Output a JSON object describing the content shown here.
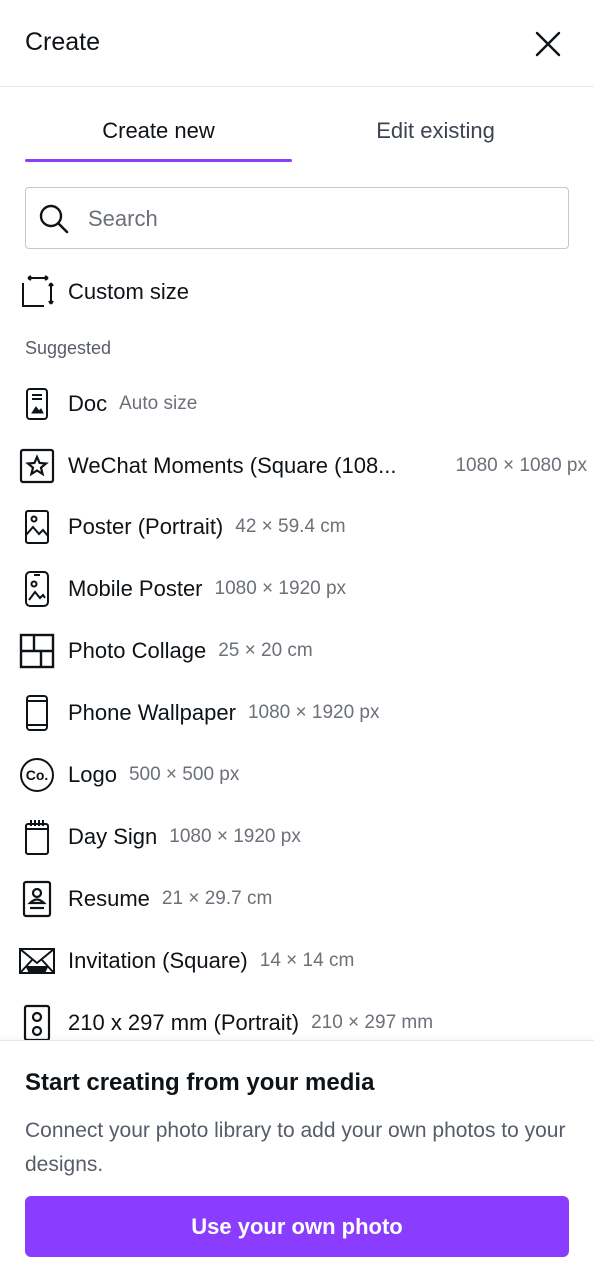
{
  "header": {
    "title": "Create",
    "close_icon": "close-icon"
  },
  "tabs": [
    {
      "label": "Create new",
      "active": true
    },
    {
      "label": "Edit existing",
      "active": false
    }
  ],
  "search": {
    "placeholder": "Search",
    "value": "",
    "icon": "search-icon"
  },
  "custom_size": {
    "label": "Custom size",
    "icon": "resize-icon"
  },
  "suggested_label": "Suggested",
  "suggested": [
    {
      "name": "Doc",
      "dim": "Auto size",
      "icon": "doc-icon"
    },
    {
      "name": "WeChat Moments (Square (108...",
      "dim": "1080 × 1080 px",
      "icon": "star-frame-icon"
    },
    {
      "name": "Poster (Portrait)",
      "dim": "42 × 59.4 cm",
      "icon": "poster-icon"
    },
    {
      "name": "Mobile Poster",
      "dim": "1080 × 1920 px",
      "icon": "mobile-poster-icon"
    },
    {
      "name": "Photo Collage",
      "dim": "25 × 20 cm",
      "icon": "collage-icon"
    },
    {
      "name": "Phone Wallpaper",
      "dim": "1080 × 1920 px",
      "icon": "phone-icon"
    },
    {
      "name": "Logo",
      "dim": "500 × 500 px",
      "icon": "logo-icon"
    },
    {
      "name": "Day Sign",
      "dim": "1080 × 1920 px",
      "icon": "day-sign-icon"
    },
    {
      "name": "Resume",
      "dim": "21 × 29.7 cm",
      "icon": "resume-icon"
    },
    {
      "name": "Invitation (Square)",
      "dim": "14 × 14 cm",
      "icon": "invitation-icon"
    },
    {
      "name": "210 x 297 mm (Portrait)",
      "dim": "210 × 297 mm",
      "icon": "portrait-sheet-icon"
    }
  ],
  "media_panel": {
    "heading": "Start creating from your media",
    "body": "Connect your photo library to add your own photos to your designs.",
    "button_label": "Use your own photo"
  },
  "colors": {
    "accent": "#8b3dff",
    "text": "#0e1318",
    "muted": "#6b7079",
    "border": "#c4c7cc"
  }
}
